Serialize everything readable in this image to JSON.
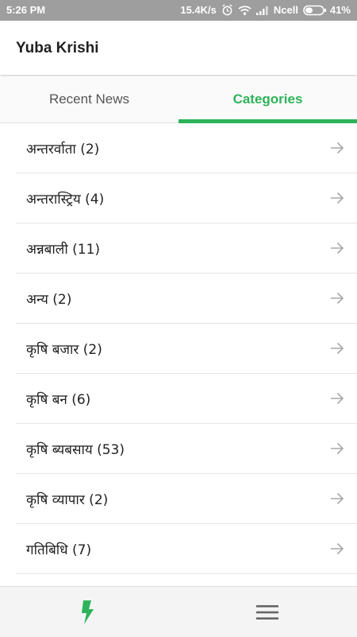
{
  "status_bar": {
    "time": "5:26 PM",
    "speed": "15.4K/s",
    "carrier": "Ncell",
    "battery": "41%"
  },
  "app_bar": {
    "title": "Yuba Krishi"
  },
  "tabs": [
    {
      "label": "Recent News",
      "active": false
    },
    {
      "label": "Categories",
      "active": true
    }
  ],
  "categories": [
    {
      "label": "अन्तरर्वाता (2)"
    },
    {
      "label": "अन्तरास्ट्रिय (4)"
    },
    {
      "label": "अन्नबाली (11)"
    },
    {
      "label": "अन्य (2)"
    },
    {
      "label": "कृषि बजार (2)"
    },
    {
      "label": "कृषि बन (6)"
    },
    {
      "label": "कृषि ब्यबसाय (53)"
    },
    {
      "label": "कृषि व्यापार (2)"
    },
    {
      "label": "गतिबिधि (7)"
    }
  ],
  "icons": {
    "row_arrow": "arrow-right-icon",
    "nav_news": "lightning-bolt-icon",
    "nav_menu": "hamburger-menu-icon"
  },
  "colors": {
    "accent": "#2eb35a",
    "status_bar": "#9e9e9e"
  }
}
